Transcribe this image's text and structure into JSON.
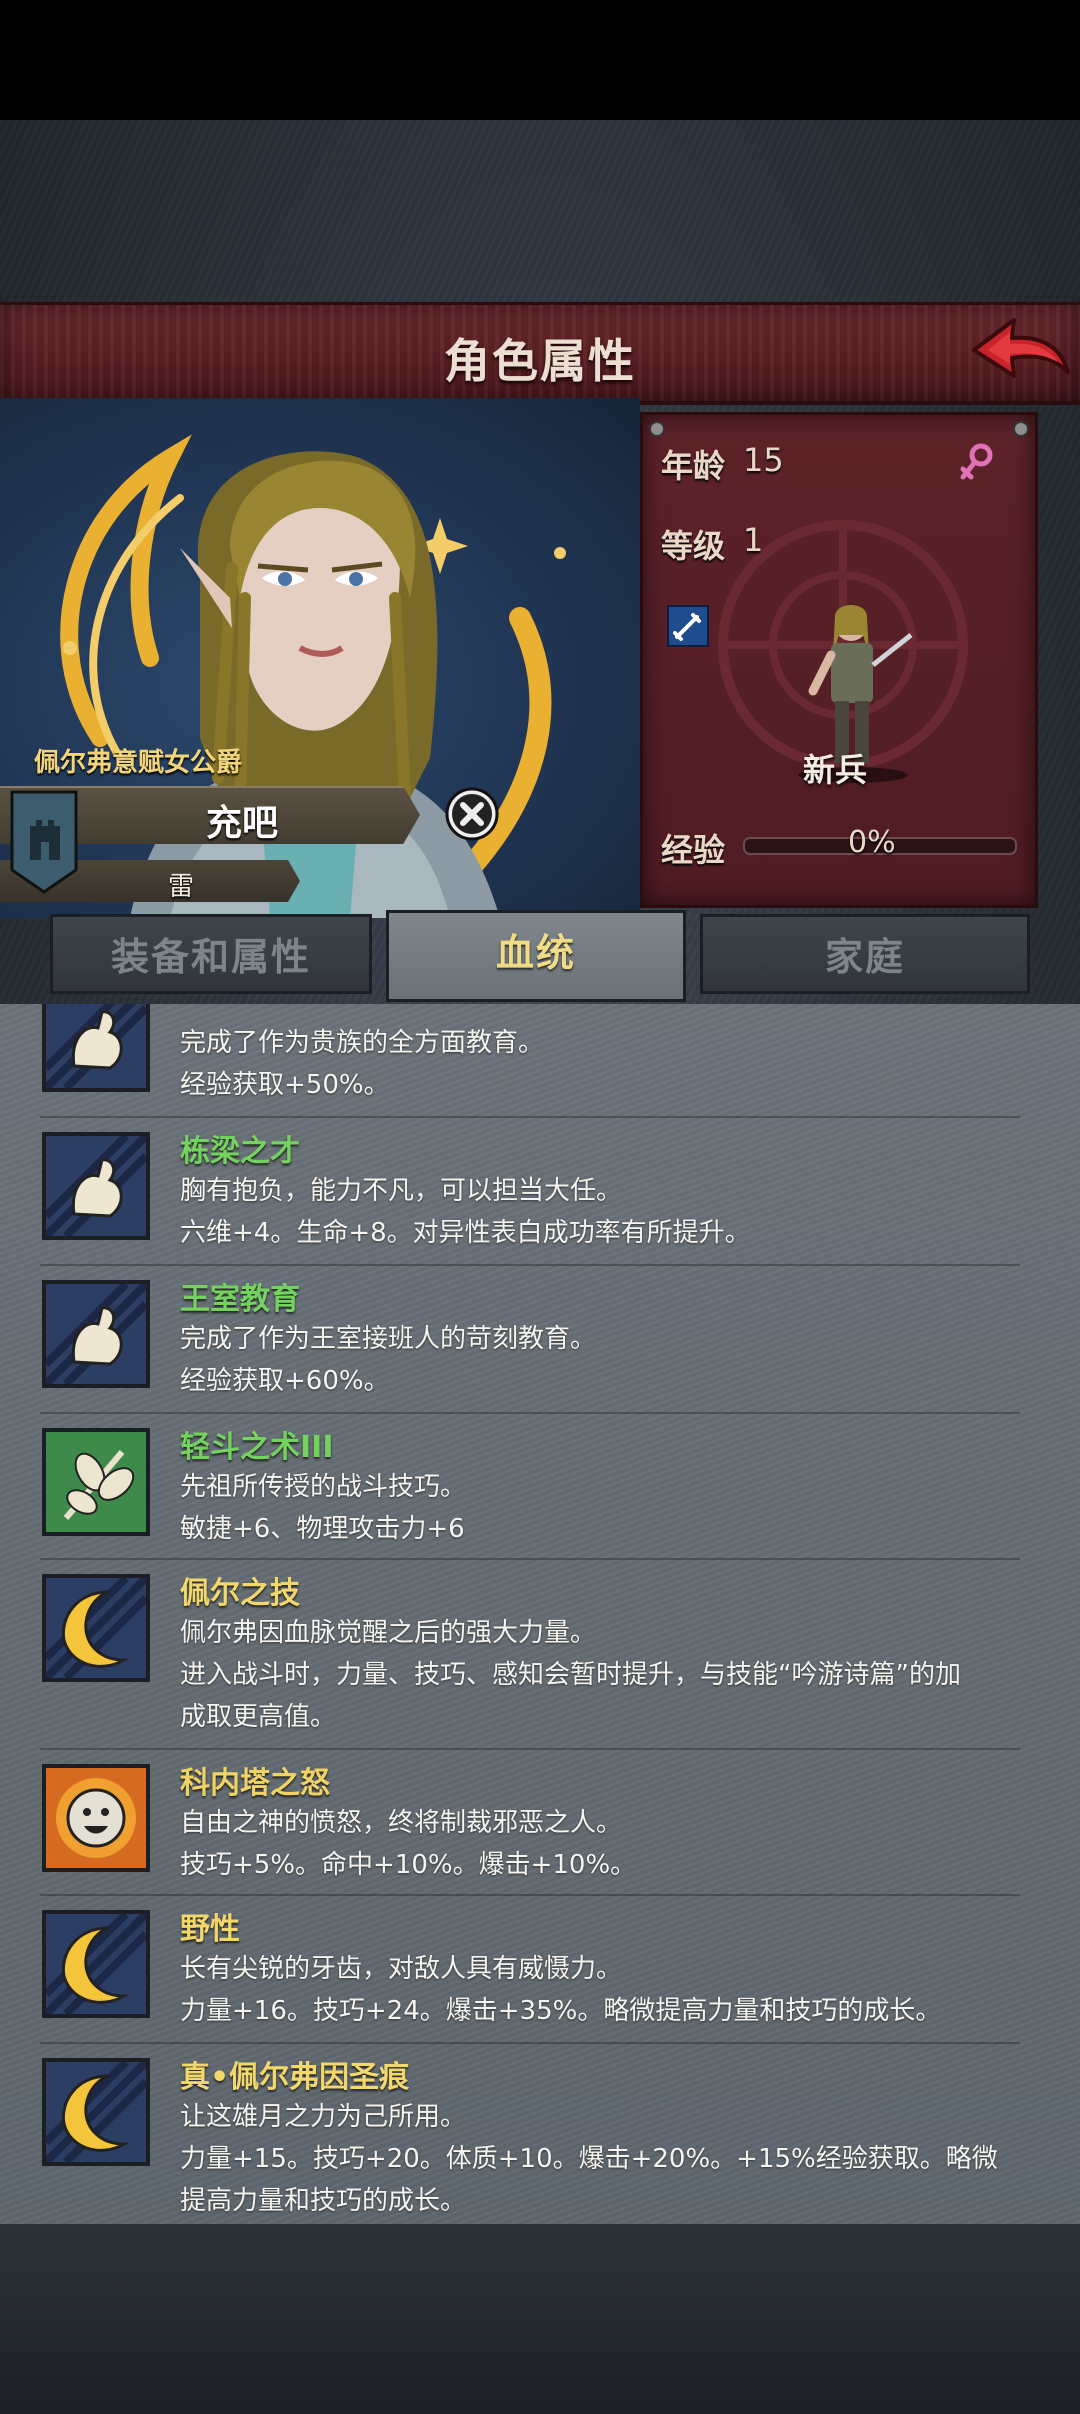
{
  "header": {
    "title": "角色属性"
  },
  "character": {
    "nobility_title": "佩尔弗意赋女公爵",
    "name": "充吧",
    "element": "雷"
  },
  "stats": {
    "age_label": "年龄",
    "age_value": "15",
    "level_label": "等级",
    "level_value": "1",
    "class_name": "新兵",
    "exp_label": "经验",
    "exp_value": "0%",
    "exp_progress": 0
  },
  "tabs": [
    {
      "label": "装备和属性",
      "active": false
    },
    {
      "label": "血统",
      "active": true
    },
    {
      "label": "家庭",
      "active": false
    }
  ],
  "traits": [
    {
      "name": "",
      "icon": "muscle-arm-icon",
      "desc": [
        "完成了作为贵族的全方面教育。",
        "经验获取+50%。"
      ]
    },
    {
      "name": "栋梁之才",
      "icon": "muscle-arm-icon",
      "desc": [
        "胸有抱负，能力不凡，可以担当大任。",
        "六维+4。生命+8。对异性表白成功率有所提升。"
      ]
    },
    {
      "name": "王室教育",
      "icon": "muscle-arm-icon",
      "desc": [
        "完成了作为王室接班人的苛刻教育。",
        "经验获取+60%。"
      ]
    },
    {
      "name": "轻斗之术III",
      "icon": "leaf-branch-icon",
      "desc": [
        "先祖所传授的战斗技巧。",
        "敏捷+6、物理攻击力+6"
      ]
    },
    {
      "name": "佩尔之技",
      "icon": "crescent-moon-icon",
      "desc": [
        "佩尔弗因血脉觉醒之后的强大力量。",
        "进入战斗时，力量、技巧、感知会暂时提升，与技能“吟游诗篇”的加",
        "成取更高值。"
      ]
    },
    {
      "name": "科内塔之怒",
      "icon": "sun-face-icon",
      "desc": [
        "自由之神的愤怒，终将制裁邪恶之人。",
        "技巧+5%。命中+10%。爆击+10%。"
      ]
    },
    {
      "name": "野性",
      "icon": "crescent-moon-icon",
      "desc": [
        "长有尖锐的牙齿，对敌人具有威慑力。",
        "力量+16。技巧+24。爆击+35%。略微提高力量和技巧的成长。"
      ]
    },
    {
      "name": "真•佩尔弗因圣痕",
      "icon": "crescent-moon-icon",
      "desc": [
        "让这雄月之力为己所用。",
        "力量+15。技巧+20。体质+10。爆击+20%。+15%经验获取。略微",
        "提高力量和技巧的成长。"
      ]
    }
  ]
}
